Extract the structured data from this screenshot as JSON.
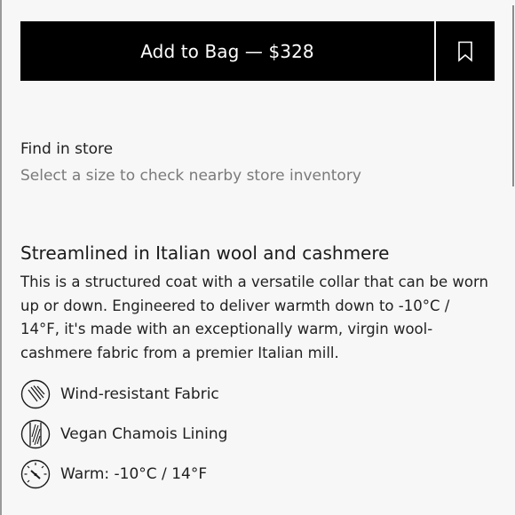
{
  "purchase": {
    "add_to_bag_label": "Add to Bag — $328",
    "save_icon": "bookmark-icon"
  },
  "store": {
    "title": "Find in store",
    "subtitle": "Select a size to check nearby store inventory"
  },
  "description": {
    "heading": "Streamlined in Italian wool and cashmere",
    "body": "This is a structured coat with a versatile collar that can be worn up or down. Engineered to deliver warmth down to -10°C / 14°F, it's made with an exceptionally warm, virgin wool-cashmere fabric from a premier Italian mill."
  },
  "features": [
    {
      "label": "Wind-resistant Fabric",
      "icon": "wind-resistant-icon"
    },
    {
      "label": "Vegan Chamois Lining",
      "icon": "lining-icon"
    },
    {
      "label": "Warm: -10°C / 14°F",
      "icon": "gauge-icon"
    }
  ],
  "colors": {
    "button_bg": "#000000",
    "button_text": "#ffffff",
    "muted_text": "#7a7a7a",
    "page_bg": "#f7f7f7"
  }
}
